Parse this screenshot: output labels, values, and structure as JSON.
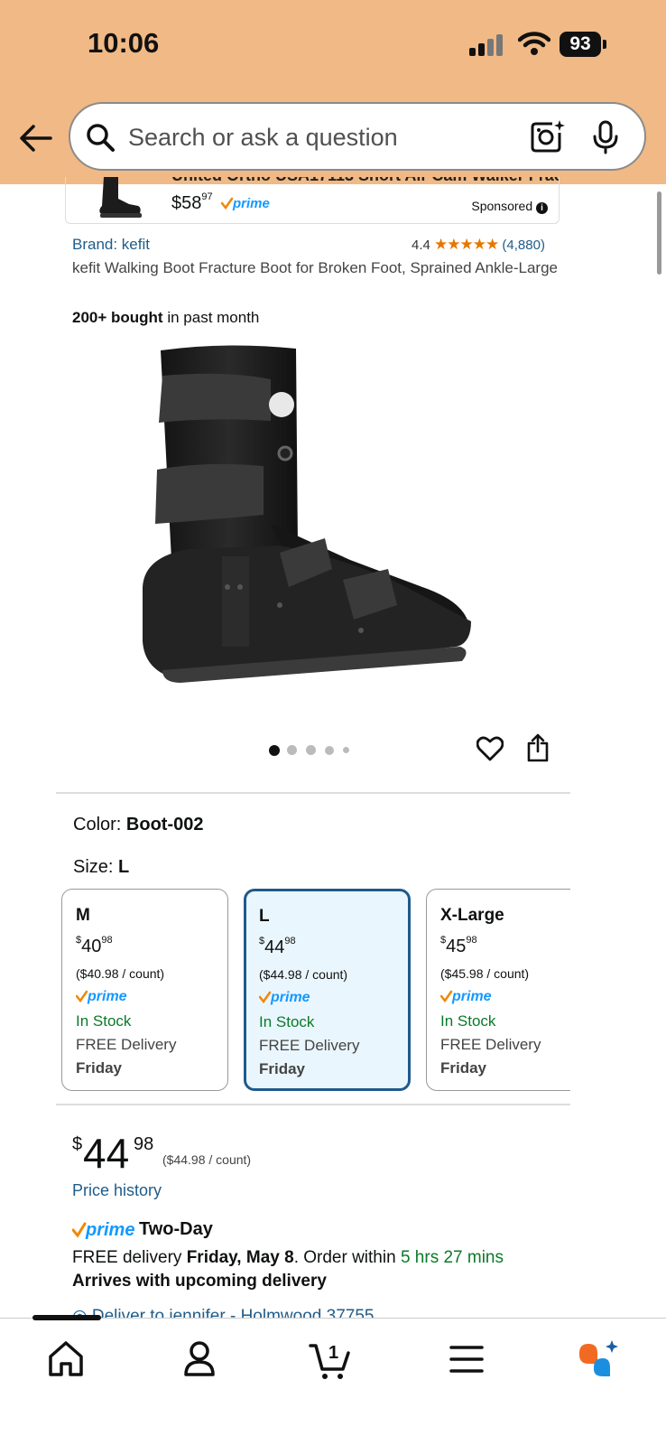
{
  "status_bar": {
    "time": "10:06",
    "battery": "93"
  },
  "search": {
    "placeholder": "Search or ask a question"
  },
  "sponsored_ad": {
    "title": "United Ortho USA17113 Short Air Cam Walker Frac...",
    "price_whole": "$58",
    "price_fraction": "97",
    "badge": "prime",
    "sponsored_label": "Sponsored"
  },
  "product": {
    "brand": "Brand: kefit",
    "rating": "4.4",
    "stars": "★★★★★",
    "rating_count": "(4,880)",
    "title": "kefit Walking Boot Fracture Boot for Broken Foot, Sprained Ankle-Large",
    "bought_bold": "200+ bought",
    "bought_rest": " in past month",
    "image_count": 5,
    "active_image": 1
  },
  "variation": {
    "color_label": "Color: ",
    "color_value": "Boot-002",
    "size_label": "Size: ",
    "size_value": "L",
    "sizes": [
      {
        "name": "M",
        "cur": "$",
        "whole": "40",
        "frac": "98",
        "unit": "($40.98 / count)",
        "prime": "prime",
        "stock": "In Stock",
        "delivery": "FREE Delivery",
        "day": "Friday"
      },
      {
        "name": "L",
        "cur": "$",
        "whole": "44",
        "frac": "98",
        "unit": "($44.98 / count)",
        "prime": "prime",
        "stock": "In Stock",
        "delivery": "FREE Delivery",
        "day": "Friday"
      },
      {
        "name": "X-Large",
        "cur": "$",
        "whole": "45",
        "frac": "98",
        "unit": "($45.98 / count)",
        "prime": "prime",
        "stock": "In Stock",
        "delivery": "FREE Delivery",
        "day": "Friday"
      }
    ]
  },
  "buy_box": {
    "currency": "$",
    "price_whole": "44",
    "price_fraction": "98",
    "unit_price": "($44.98 / count)",
    "price_history": "Price history",
    "prime_label": "prime",
    "two_day": "Two-Day",
    "free_delivery_prefix": "FREE delivery ",
    "delivery_date": "Friday, May 8",
    "order_within": ". Order within ",
    "countdown": "5 hrs 27 mins",
    "arrives": "Arrives with upcoming delivery",
    "deliver_to": "Deliver to jennifer - Holmwood 37755"
  },
  "tabbar": {
    "cart_count": "1"
  },
  "colors": {
    "header_bg": "#f0b985",
    "link": "#1f5c8a",
    "green": "#0b7a29",
    "prime_blue": "#1399ff",
    "star": "#e77600",
    "selected_border": "#1f5a8c"
  }
}
